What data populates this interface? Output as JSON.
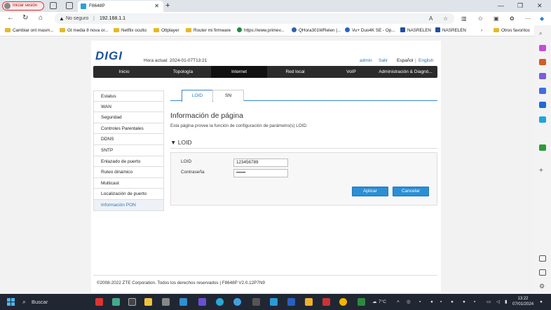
{
  "browser": {
    "signin_label": "Iniciar sesión",
    "tab_title": "F8648P",
    "address_security": "No seguro",
    "address_url": "192.168.1.1",
    "bookmarks": [
      {
        "label": "Cambiar ont masm...",
        "type": "folder"
      },
      {
        "label": "Gt media 8 nova or...",
        "type": "folder"
      },
      {
        "label": "Netflix oculto",
        "type": "folder"
      },
      {
        "label": "Ottplayer",
        "type": "folder"
      },
      {
        "label": "Router mi firmware",
        "type": "folder"
      },
      {
        "label": "https://www.primev...",
        "type": "site"
      },
      {
        "label": "QHora301WRelen |...",
        "type": "site"
      },
      {
        "label": "Vu+ Duo4K SE - Op...",
        "type": "site"
      },
      {
        "label": "NASRELEN",
        "type": "site"
      },
      {
        "label": "NASRELEN",
        "type": "site"
      },
      {
        "label": "Otros favoritos",
        "type": "folder"
      }
    ]
  },
  "router": {
    "logo": "DIGI",
    "time_label": "Hora actual: 2024-01-07T13:21",
    "user": "admin",
    "logout": "Salir",
    "lang_es": "Español",
    "lang_sep": "|",
    "lang_en": "English",
    "nav": [
      "Inicio",
      "Topología",
      "Internet",
      "Red local",
      "VoIP",
      "Administración & Diagnó..."
    ],
    "nav_active": "Internet",
    "menu": [
      "Estatus",
      "WAN",
      "Seguridad",
      "Controles Parentales",
      "DDNS",
      "SNTP",
      "Enlazado de puerto",
      "Ruteo dinámico",
      "Multicast",
      "Localización de puerto",
      "Información PON"
    ],
    "menu_active": "Información PON",
    "subtabs": [
      "LOID",
      "SN"
    ],
    "subtab_active": "LOID",
    "page_title": "Información de página",
    "page_desc": "Esta página provee la función de configuración de parámetro(s) LOID.",
    "section_arrow": "▼",
    "section_title": "LOID",
    "form": {
      "loid_label": "LOID",
      "loid_value": "123456789",
      "password_label": "Contraseña",
      "password_value": "••••••",
      "apply": "Aplicar",
      "cancel": "Cancelar"
    },
    "footer": "©2008-2022 ZTE Corporation. Todos los derechos reservados  |   F8648P V2.0.12P7N9"
  },
  "taskbar": {
    "search_label": "Buscar",
    "weather": "7°C",
    "time": "13:22",
    "date": "07/01/2024"
  },
  "colors": {
    "accent": "#2a8fd6",
    "nav_bg": "#2b2b2b",
    "logo": "#1a52a0"
  }
}
